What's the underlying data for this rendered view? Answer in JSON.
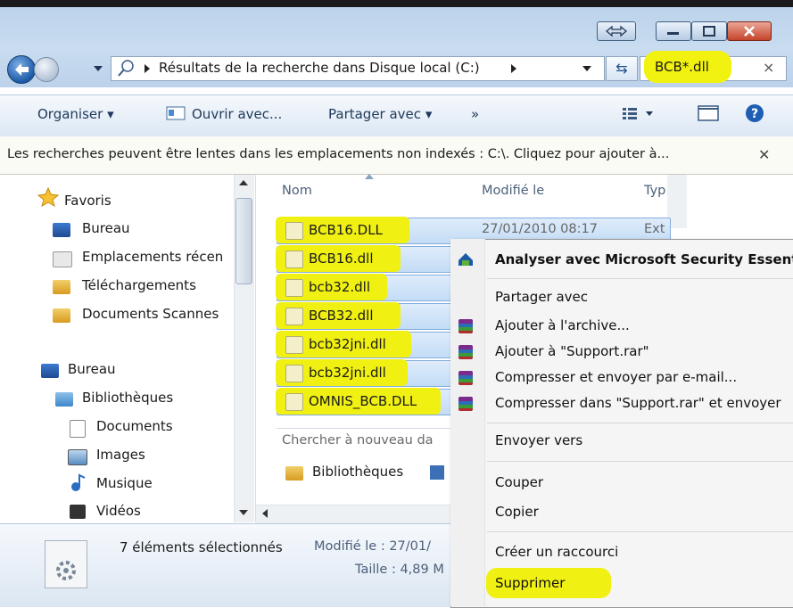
{
  "address": {
    "path": "Résultats de la recherche dans Disque local (C:)",
    "search_query": "BCB*.dll"
  },
  "toolbar": {
    "organize": "Organiser",
    "open_with": "Ouvrir avec...",
    "share": "Partager avec",
    "more": "»"
  },
  "infobar": {
    "message": "Les recherches peuvent être lentes dans les emplacements non indexés : C:\\. Cliquez pour ajouter à..."
  },
  "nav": {
    "favorites": "Favoris",
    "items": [
      "Bureau",
      "Emplacements récen",
      "Téléchargements",
      "Documents Scannes"
    ],
    "desktop": "Bureau",
    "libraries": "Bibliothèques",
    "library_items": [
      "Documents",
      "Images",
      "Musique",
      "Vidéos"
    ]
  },
  "list": {
    "columns": [
      "Nom",
      "Modifié le",
      "Typ"
    ],
    "files": [
      "BCB16.DLL",
      "BCB16.dll",
      "bcb32.dll",
      "BCB32.dll",
      "bcb32jni.dll",
      "bcb32jni.dll",
      "OMNIS_BCB.DLL"
    ],
    "first_modified": "27/01/2010 08:17",
    "first_type": "Ext",
    "search_again": "Chercher à nouveau da",
    "search_again_libraries": "Bibliothèques"
  },
  "details": {
    "selection": "7 éléments sélectionnés",
    "modified": "Modifié le : 27/01/",
    "size": "Taille : 4,89 M"
  },
  "context_menu": {
    "scan": "Analyser avec Microsoft Security Essent",
    "share": "Partager avec",
    "add_archive": "Ajouter à l'archive...",
    "add_support": "Ajouter à \"Support.rar\"",
    "compress_email": "Compresser et envoyer par e-mail...",
    "compress_support": "Compresser dans \"Support.rar\" et envoyer",
    "send_to": "Envoyer vers",
    "cut": "Couper",
    "copy": "Copier",
    "shortcut": "Créer un raccourci",
    "delete": "Supprimer"
  },
  "colors": {
    "highlight": "#f0f012",
    "selection": "#c3dcf6"
  }
}
